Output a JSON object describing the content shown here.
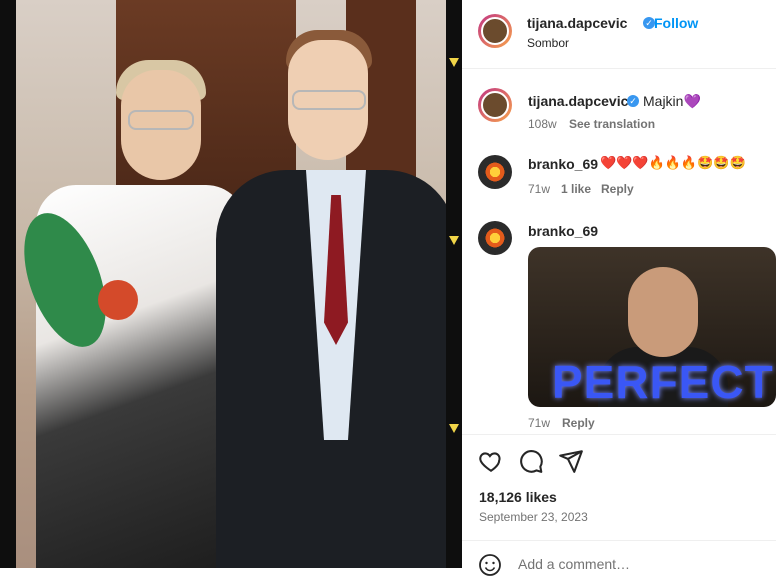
{
  "post": {
    "author": "tijana.dapcevic",
    "follow_label": "Follow",
    "location": "Sombor",
    "caption_author": "tijana.dapcevic",
    "caption_text": "Majkin💜",
    "caption_age": "108w",
    "see_translation": "See translation",
    "likes": "18,126 likes",
    "date": "September 23, 2023"
  },
  "comments": [
    {
      "user": "branko_69",
      "text": "❤️❤️❤️🔥🔥🔥🤩🤩🤩",
      "age": "71w",
      "likes": "1 like",
      "reply": "Reply"
    },
    {
      "user": "branko_69",
      "gif_text": "PERFECT",
      "age": "71w",
      "reply": "Reply"
    }
  ],
  "add_comment_placeholder": "Add a comment…",
  "icons": [
    "heart-icon",
    "comment-icon",
    "share-icon",
    "emoji-icon",
    "verified-icon"
  ],
  "colors": {
    "accent": "#0095f6",
    "verified": "#3897f0",
    "meta_text": "#737373"
  }
}
